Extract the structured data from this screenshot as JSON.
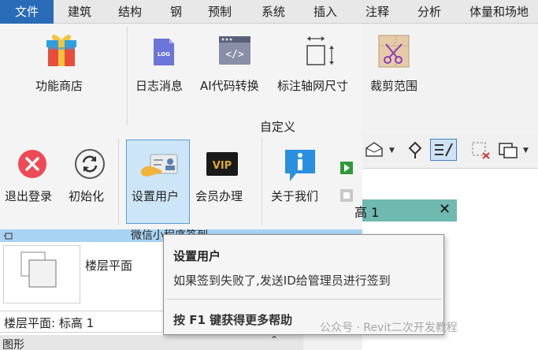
{
  "menu": {
    "tabs": [
      "文件",
      "建筑",
      "结构",
      "钢",
      "预制",
      "系统",
      "插入",
      "注释",
      "分析",
      "体量和场地"
    ]
  },
  "ribbon": {
    "group_title": "自定义",
    "row1": {
      "store": "功能商店",
      "log": "日志消息",
      "ai_convert": "AI代码转换",
      "dimension": "标注轴网尺寸",
      "crop": "裁剪范围"
    },
    "row2": {
      "logout": "退出登录",
      "init": "初始化",
      "set_user": "设置用户",
      "membership": "会员办理",
      "about": "关于我们"
    },
    "icon_text": {
      "log": "LOG",
      "code": "</>",
      "vip": "VIP"
    }
  },
  "view": {
    "tab_label": "高 1",
    "close": "✕"
  },
  "panel": {
    "header": "微信小程序签到",
    "floor_plan": "楼层平面",
    "level_value": "楼层平面: 标高 1",
    "graphics": "图形",
    "collapse": "⌃"
  },
  "tooltip": {
    "title": "设置用户",
    "description": "如果签到失败了,发送ID给管理员进行签到",
    "help": "按 F1 键获得更多帮助"
  },
  "watermark": "公众号 · Revit二次开发教程",
  "colors": {
    "accent": "#2a6bb8",
    "selected_button": "#cde6f7",
    "panel_header": "#a9d3f3",
    "view_tab": "#6fb9b0"
  }
}
